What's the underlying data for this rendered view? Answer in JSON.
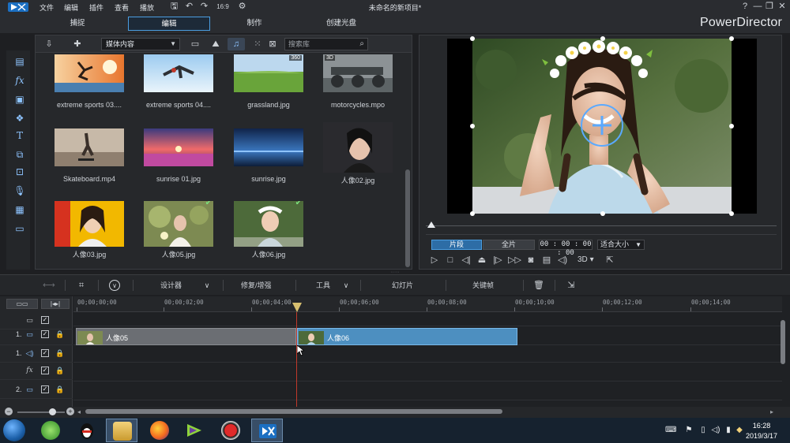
{
  "titlebar": {
    "menus": [
      "文件",
      "编辑",
      "插件",
      "查看",
      "播放"
    ],
    "window_title": "未命名的新项目*",
    "controls": [
      "?",
      "—",
      "❐",
      "✕"
    ]
  },
  "modes": {
    "tabs": [
      "捕捉",
      "编辑",
      "制作",
      "创建光盘"
    ],
    "active": "编辑",
    "brand": "PowerDirector"
  },
  "library": {
    "dropdown_value": "媒体内容",
    "search_placeholder": "搜索库",
    "items": [
      {
        "label": "extreme sports 03....",
        "badge": "",
        "checked": false
      },
      {
        "label": "extreme sports 04....",
        "badge": "",
        "checked": false
      },
      {
        "label": "grassland.jpg",
        "badge": "360",
        "checked": false
      },
      {
        "label": "motorcycles.mpo",
        "badge": "3D",
        "checked": false
      },
      {
        "label": "Skateboard.mp4",
        "badge": "",
        "checked": false
      },
      {
        "label": "sunrise 01.jpg",
        "badge": "",
        "checked": false
      },
      {
        "label": "sunrise.jpg",
        "badge": "",
        "checked": false
      },
      {
        "label": "人像02.jpg",
        "badge": "",
        "checked": false
      },
      {
        "label": "人像03.jpg",
        "badge": "",
        "checked": false
      },
      {
        "label": "人像05.jpg",
        "badge": "",
        "checked": true
      },
      {
        "label": "人像06.jpg",
        "badge": "",
        "checked": true
      }
    ]
  },
  "preview": {
    "segment_clip": "片段",
    "segment_full": "全片",
    "timecode": "00 : 00 : 00 : 00",
    "fit": "适合大小",
    "mode_3d": "3D"
  },
  "timeline_toolbar": {
    "designer": "设计器",
    "fix_enhance": "修复/增强",
    "tools": "工具",
    "slideshow": "幻灯片",
    "keyframe": "关键帧"
  },
  "timeline": {
    "ruler_ticks": [
      "00;00;00;00",
      "00;00;02;00",
      "00;00;04;00",
      "00;00;06;00",
      "00;00;08;00",
      "00;00;10;00",
      "00;00;12;00",
      "00;00;14;00"
    ],
    "tracks": [
      {
        "number": "",
        "type": "all"
      },
      {
        "number": "1.",
        "type": "video"
      },
      {
        "number": "1.",
        "type": "audio"
      },
      {
        "number": "",
        "type": "fx"
      },
      {
        "number": "2.",
        "type": "video"
      }
    ],
    "clips": [
      {
        "label": "人像05"
      },
      {
        "label": "人像06"
      }
    ]
  },
  "taskbar": {
    "time": "16:28",
    "date": "2019/3/17"
  },
  "colors": {
    "accent": "#4a9de0",
    "clip_selected": "#4d8fc0",
    "clip_normal": "#6b6e73",
    "playhead": "#c0392b"
  }
}
